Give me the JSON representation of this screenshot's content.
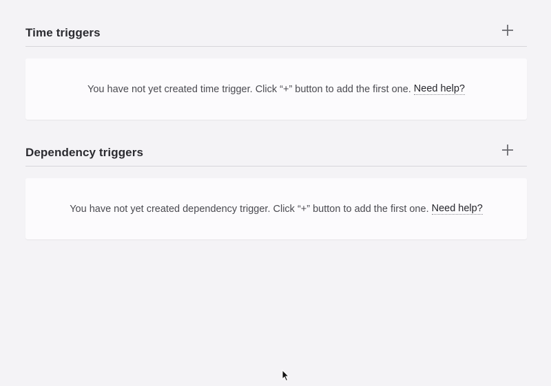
{
  "time_triggers": {
    "title": "Time triggers",
    "add_icon": "plus-icon",
    "empty_message": "You have not yet created time trigger. Click “+” button to add the first one.",
    "help_link": "Need help?"
  },
  "dependency_triggers": {
    "title": "Dependency triggers",
    "add_icon": "plus-icon",
    "empty_message": "You have not yet created dependency trigger. Click “+” button to add the first one.",
    "help_link": "Need help?"
  },
  "colors": {
    "background": "#f4f3f6",
    "card": "#fcfbfd",
    "divider": "#d6d5da",
    "icon": "#6b6b70"
  }
}
